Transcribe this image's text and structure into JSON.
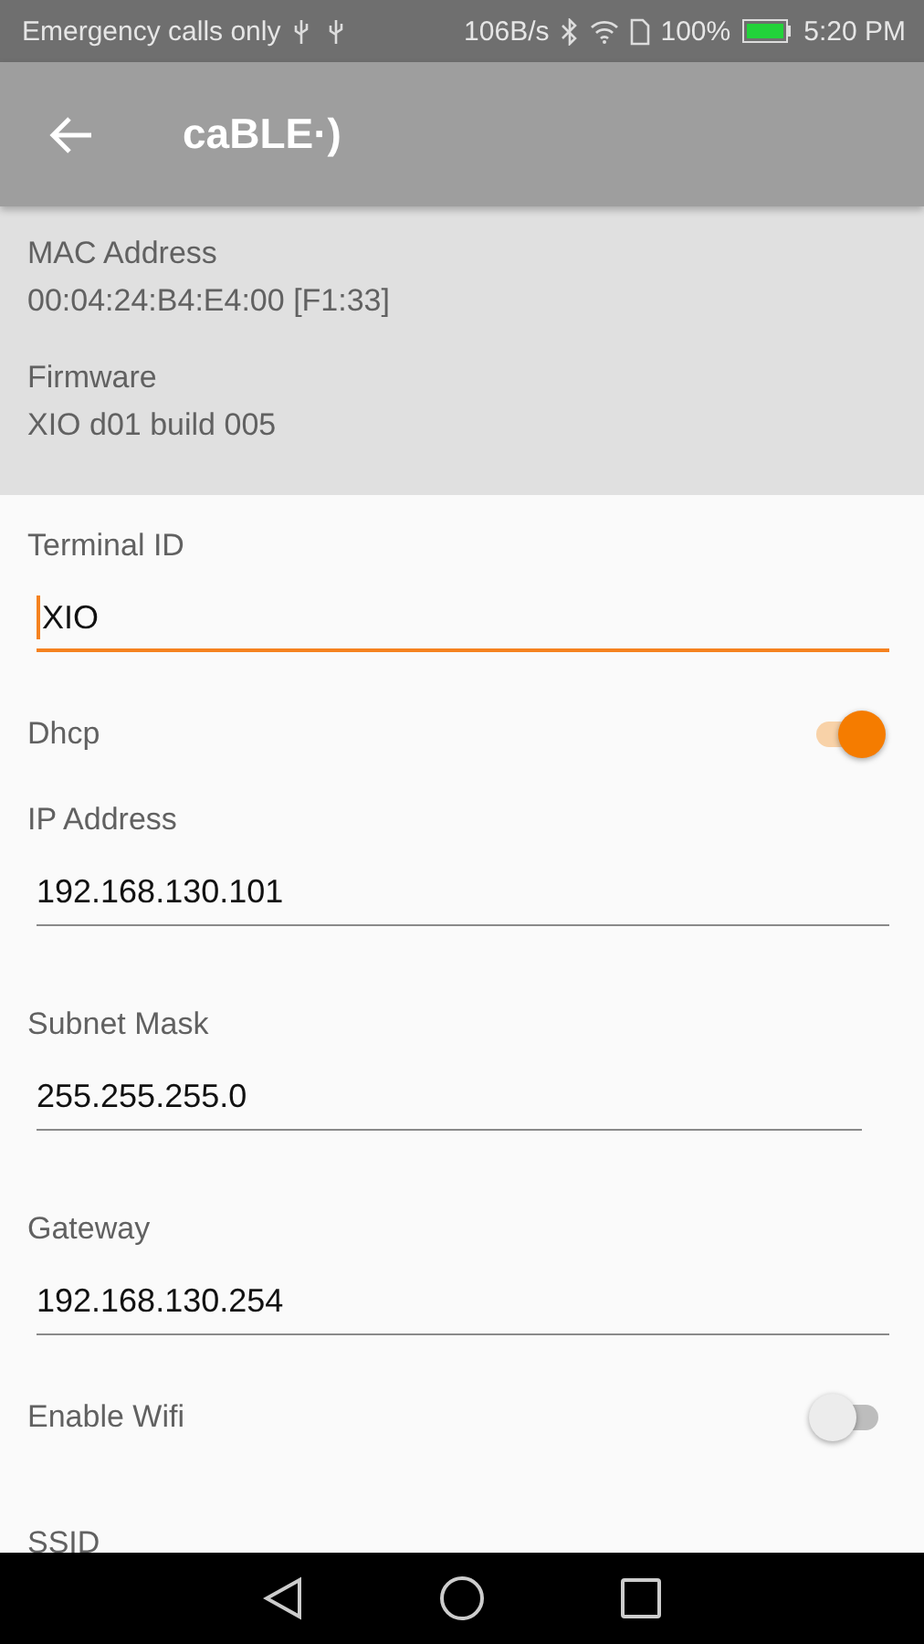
{
  "status_bar": {
    "carrier": "Emergency calls only",
    "speed": "106B/s",
    "battery": "100%",
    "time": "5:20 PM"
  },
  "app_bar": {
    "title": "caBLE·)"
  },
  "info": [
    {
      "label": "MAC Address",
      "value": "00:04:24:B4:E4:00 [F1:33]"
    },
    {
      "label": "Firmware",
      "value": "XIO d01 build 005"
    }
  ],
  "settings": [
    {
      "kind": "input",
      "label": "Terminal ID",
      "value": "XIO",
      "focused": true
    },
    {
      "kind": "switch",
      "label": "Dhcp",
      "on": true
    },
    {
      "kind": "input",
      "label": "IP Address",
      "value": "192.168.130.101",
      "focused": false
    },
    {
      "kind": "input",
      "label": "Subnet Mask",
      "value": "255.255.255.0",
      "focused": false,
      "narrow": true
    },
    {
      "kind": "input",
      "label": "Gateway",
      "value": "192.168.130.254",
      "focused": false
    },
    {
      "kind": "switch",
      "label": "Enable Wifi",
      "on": false
    },
    {
      "kind": "label",
      "label": "SSID"
    }
  ]
}
